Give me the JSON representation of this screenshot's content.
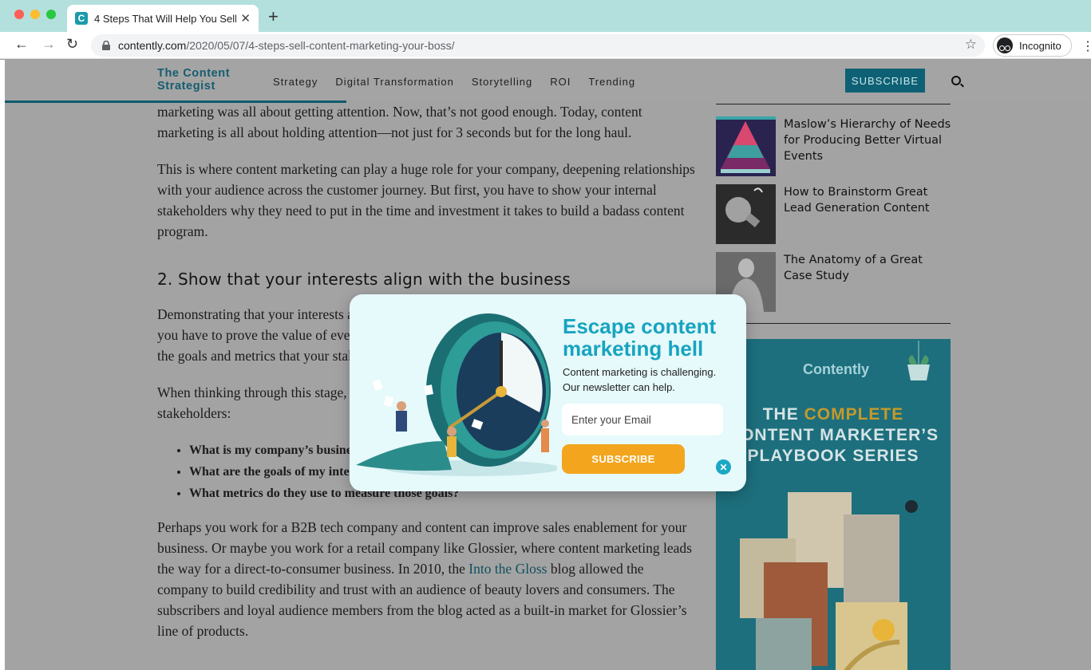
{
  "browser": {
    "tab_title": "4 Steps That Will Help You Sell",
    "tab_favicon": "C",
    "url_host": "contently.com",
    "url_path": "/2020/05/07/4-steps-sell-content-marketing-your-boss/",
    "incognito_label": "Incognito"
  },
  "site": {
    "logo": "The Content Strategist",
    "nav": [
      "Strategy",
      "Digital Transformation",
      "Storytelling",
      "ROI",
      "Trending"
    ],
    "subscribe": "SUBSCRIBE"
  },
  "article": {
    "p1": "marketing was all about getting attention. Now, that’s not good enough. Today, content marketing is all about holding attention—not just for 3 seconds but for the long haul.",
    "p2": "This is where content marketing can play a huge role for your company, deepening relationships with your audience across the customer journey. But first, you have to show your internal stakeholders why they need to put in the time and investment it takes to build a badass content program.",
    "h2": "2. Show that your interests align with the business",
    "p3": "Demonstrating that your interests align with the business is important. But that doesn’t mean you have to prove the value of everything before you get started. Instead, you want to focus on the goals and metrics that your stakeholders care about.",
    "p4": "When thinking through this stage, there are a few key questions you’ll want to ask around your stakeholders:",
    "bullets": [
      "What is my company’s business goal?",
      "What are the goals of my internal stakeholders?",
      "What metrics do they use to measure those goals?"
    ],
    "p5_before": "Perhaps you work for a B2B tech company and content can improve sales enablement for your business. Or maybe you work for a retail company like Glossier, where content marketing leads the way for a direct-to-consumer business. In 2010, the ",
    "p5_link": "Into the Gloss",
    "p5_after": " blog allowed the company to build credibility and trust with an audience of beauty lovers and consumers. The subscribers and loyal audience members from the blog acted as a built-in market for Glossier’s line of products."
  },
  "sidebar": {
    "items": [
      {
        "title": "Maslow’s Hierarchy of Needs for Producing Better Virtual Events"
      },
      {
        "title": "How to Brainstorm Great Lead Generation Content"
      },
      {
        "title": "The Anatomy of a Great Case Study"
      }
    ],
    "promo": {
      "brand": "Contently",
      "title_a": "THE ",
      "title_hl": "COMPLETE",
      "title_b": "CONTENT MARKETER’S",
      "title_c": "PLAYBOOK SERIES"
    }
  },
  "popup": {
    "heading": "Escape content marketing hell",
    "desc1": "Content marketing is challenging.",
    "desc2": "Our newsletter can help.",
    "email_placeholder": "Enter your Email",
    "button": "SUBSCRIBE",
    "close": "✕"
  },
  "colors": {
    "accent": "#17a4c0",
    "button": "#f2a51d",
    "brand_dark": "#0e6174"
  }
}
